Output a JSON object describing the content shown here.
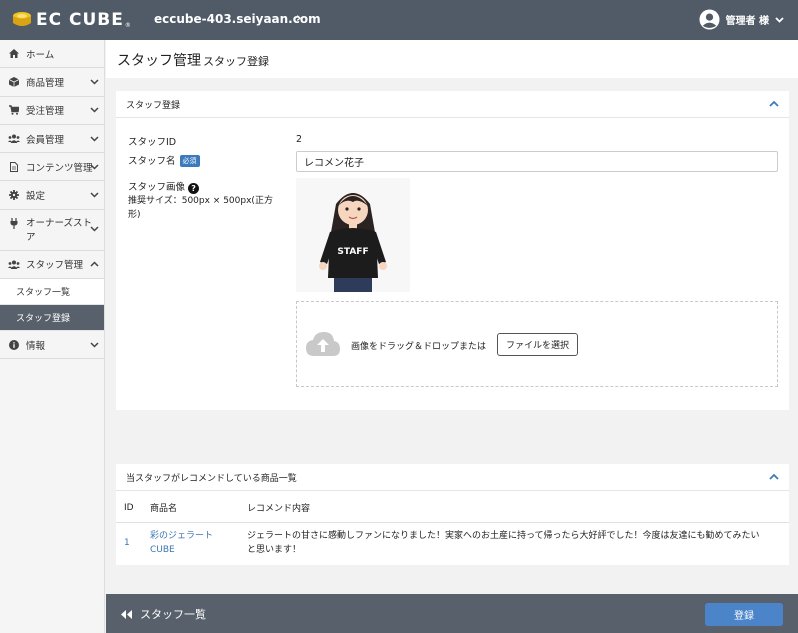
{
  "header": {
    "logo_text": "EC CUBE",
    "logo_tm": "®",
    "site_url": "eccube-403.seiyaan.com",
    "admin_name": "管理者 様"
  },
  "sidebar": {
    "items": [
      {
        "label": "ホーム",
        "icon": "home-icon"
      },
      {
        "label": "商品管理",
        "icon": "cube-icon"
      },
      {
        "label": "受注管理",
        "icon": "cart-icon"
      },
      {
        "label": "会員管理",
        "icon": "users-icon"
      },
      {
        "label": "コンテンツ管理",
        "icon": "file-icon"
      },
      {
        "label": "設定",
        "icon": "gear-icon"
      },
      {
        "label": "オーナーズストア",
        "icon": "plug-icon"
      },
      {
        "label": "スタッフ管理",
        "icon": "users-icon"
      },
      {
        "label": "情報",
        "icon": "info-icon"
      }
    ],
    "sub_items": [
      {
        "label": "スタッフ一覧"
      },
      {
        "label": "スタッフ登録"
      }
    ]
  },
  "page": {
    "title": "スタッフ管理",
    "subtitle": "スタッフ登録"
  },
  "staff_card": {
    "title": "スタッフ登録",
    "id_label": "スタッフID",
    "id_value": "2",
    "name_label": "スタッフ名",
    "required_badge": "必須",
    "name_value": "レコメン花子",
    "image_label": "スタッフ画像",
    "image_hint": "推奨サイズ：500px × 500px(正方形)",
    "photo_text": "STAFF",
    "drop_text": "画像をドラッグ＆ドロップまたは",
    "file_button": "ファイルを選択"
  },
  "recommend_card": {
    "title": "当スタッフがレコメンドしている商品一覧",
    "columns": [
      "ID",
      "商品名",
      "レコメンド内容"
    ],
    "rows": [
      {
        "id": "1",
        "product": "彩のジェラートCUBE",
        "comment": "ジェラートの甘さに感動しファンになりました！実家へのお土産に持って帰ったら大好評でした！今度は友達にも勧めてみたいと思います！"
      }
    ]
  },
  "footer": {
    "back_label": "スタッフ一覧",
    "save_label": "登録"
  },
  "colors": {
    "header_bg": "#515b68",
    "accent_blue": "#4b84c8",
    "link_blue": "#3a76b4"
  }
}
